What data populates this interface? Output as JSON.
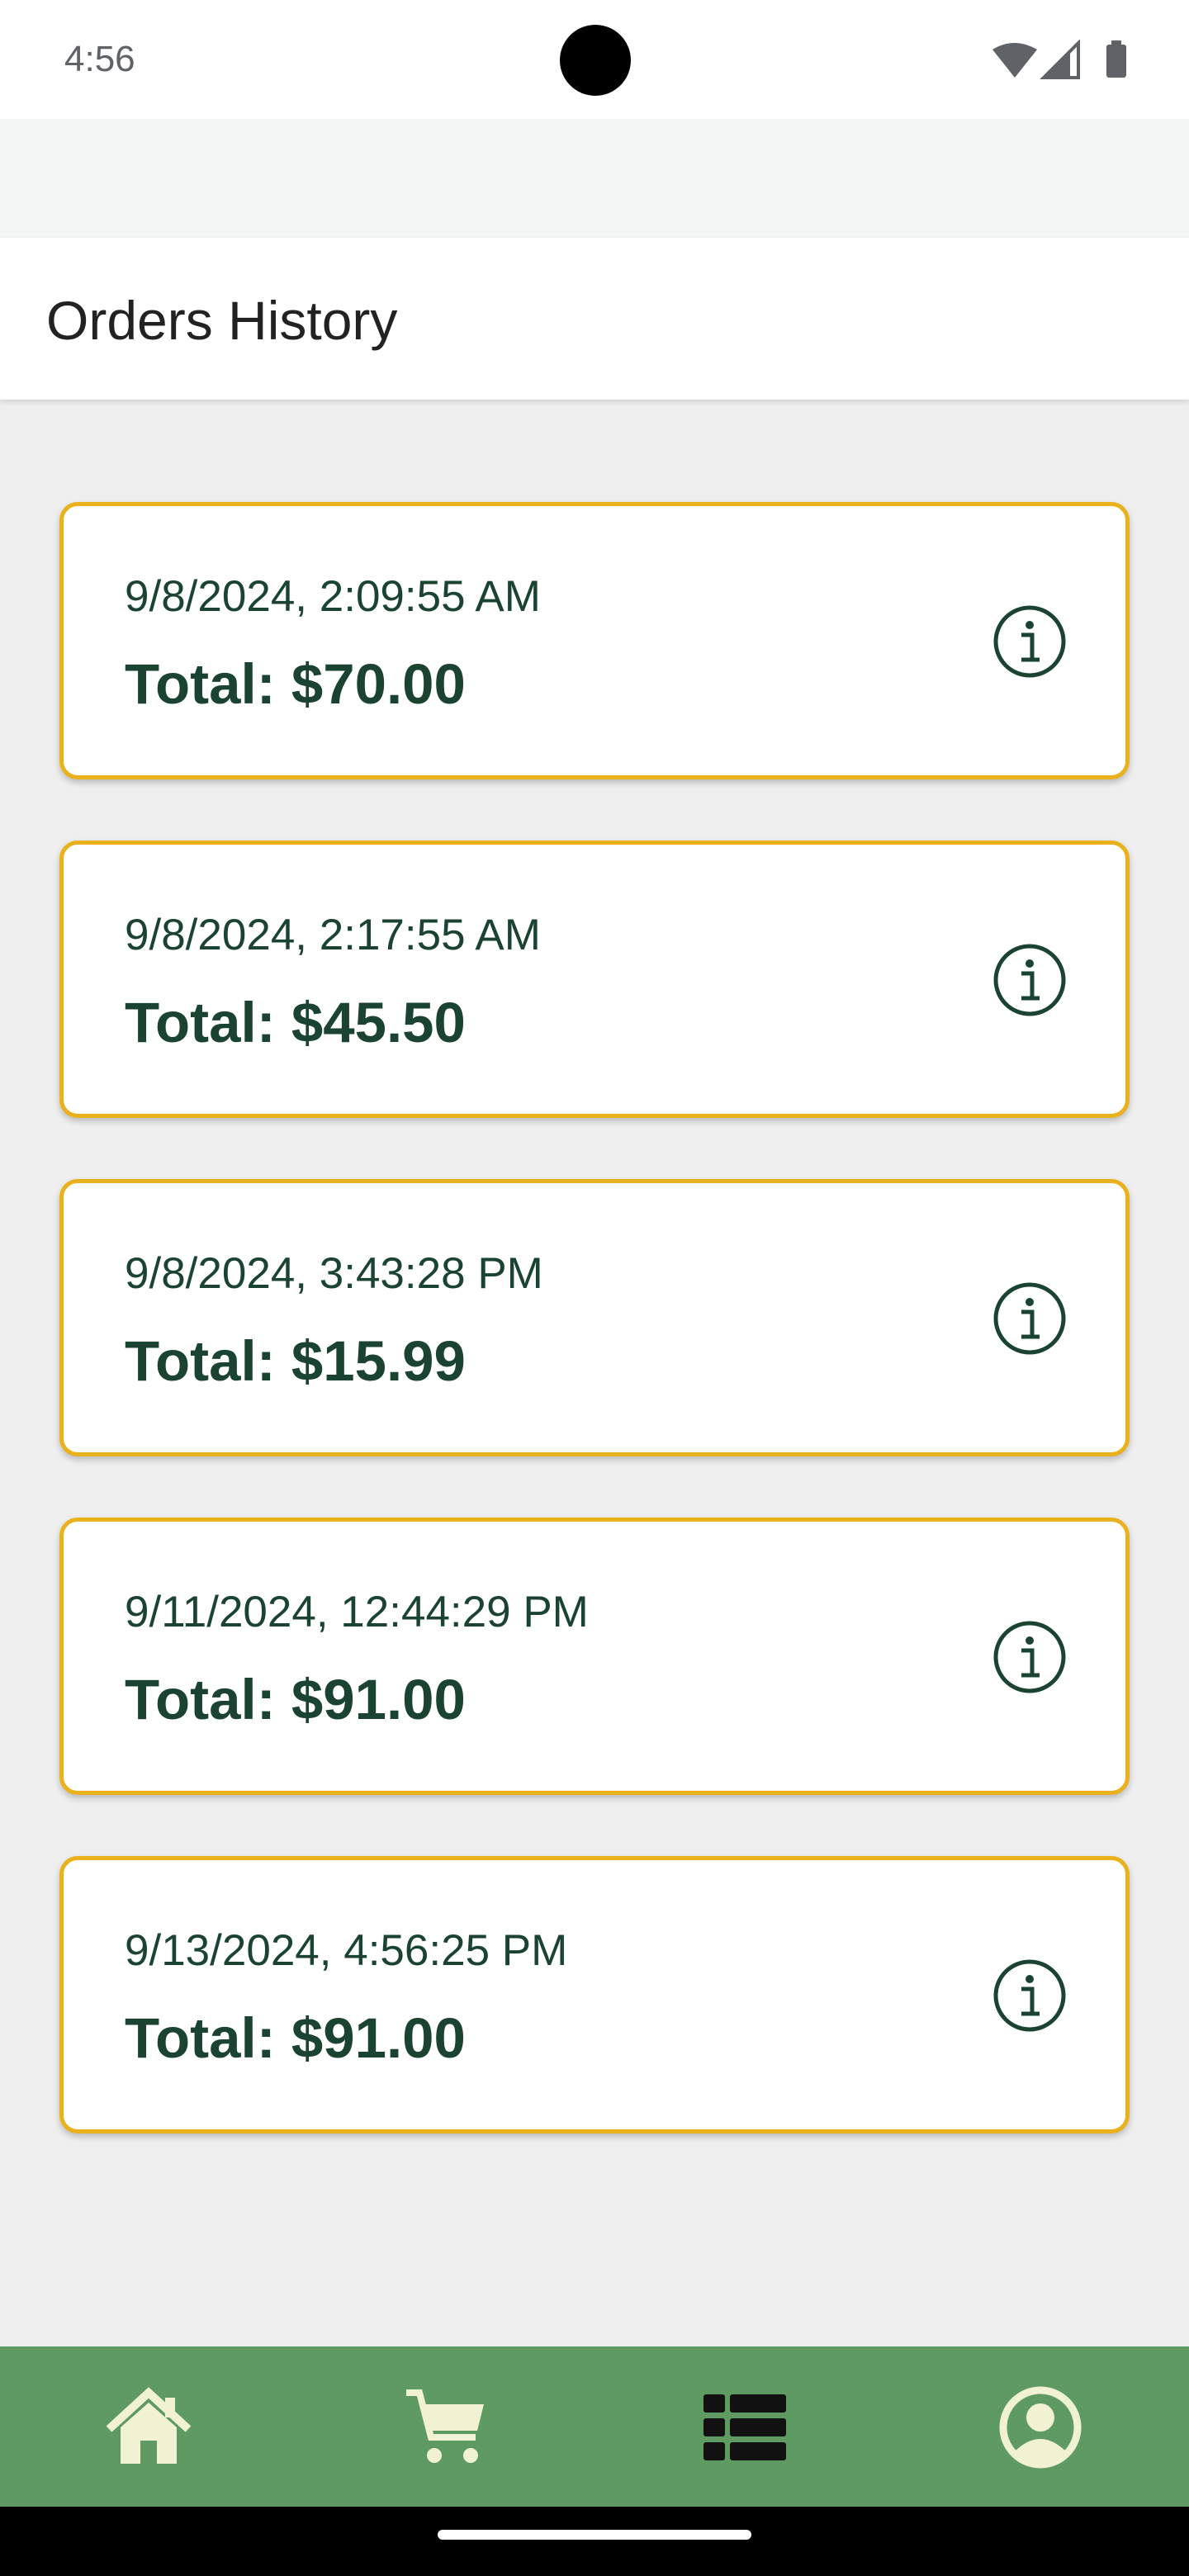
{
  "status_bar": {
    "time": "4:56",
    "icons": [
      "wifi-icon",
      "cellular-signal-icon",
      "battery-icon"
    ]
  },
  "header": {
    "title": "Orders History"
  },
  "orders": [
    {
      "date": "9/8/2024, 2:09:55 AM",
      "total": "Total: $70.00"
    },
    {
      "date": "9/8/2024, 2:17:55 AM",
      "total": "Total: $45.50"
    },
    {
      "date": "9/8/2024, 3:43:28 PM",
      "total": "Total: $15.99"
    },
    {
      "date": "9/11/2024, 12:44:29 PM",
      "total": "Total: $91.00"
    },
    {
      "date": "9/13/2024, 4:56:25 PM",
      "total": "Total: $91.00"
    }
  ],
  "bottom_nav": {
    "items": [
      {
        "icon": "home-icon",
        "active": false
      },
      {
        "icon": "cart-icon",
        "active": false
      },
      {
        "icon": "orders-list-icon",
        "active": true
      },
      {
        "icon": "profile-icon",
        "active": false
      }
    ]
  },
  "colors": {
    "card_border": "#e9b21d",
    "text_dark_green": "#1b4332",
    "nav_background": "#5f9a63",
    "nav_icon_inactive": "#f1f2d2",
    "nav_icon_active": "#111111"
  }
}
